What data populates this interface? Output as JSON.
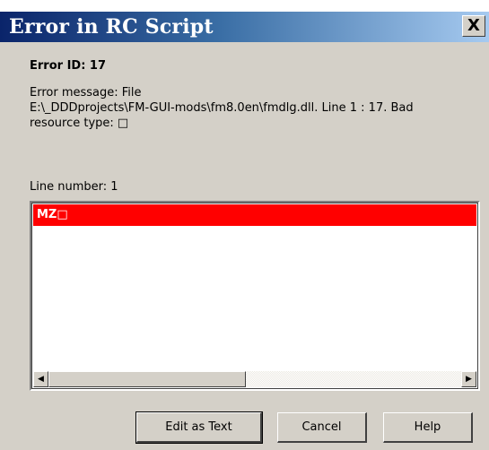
{
  "window": {
    "title": "Error in RC Script",
    "close_label": "X"
  },
  "error": {
    "id_text": "Error ID: 17",
    "message_line1": "Error message: File",
    "message_line2": "E:\\_DDDprojects\\FM-GUI-mods\\fm8.0en\\fmdlg.dll. Line 1 : 17. Bad",
    "message_line3": "resource type: □"
  },
  "line_number_text": "Line number: 1",
  "listbox": {
    "rows": [
      "MZ□"
    ]
  },
  "scrollbar": {
    "left_arrow": "◀",
    "right_arrow": "▶"
  },
  "buttons": {
    "edit_as_text": "Edit as Text",
    "cancel": "Cancel",
    "help": "Help"
  },
  "colors": {
    "title_gradient_start": "#0a246a",
    "title_gradient_end": "#a6caf0",
    "selected_row": "#ff0000",
    "dialog_face": "#d4d0c8"
  }
}
